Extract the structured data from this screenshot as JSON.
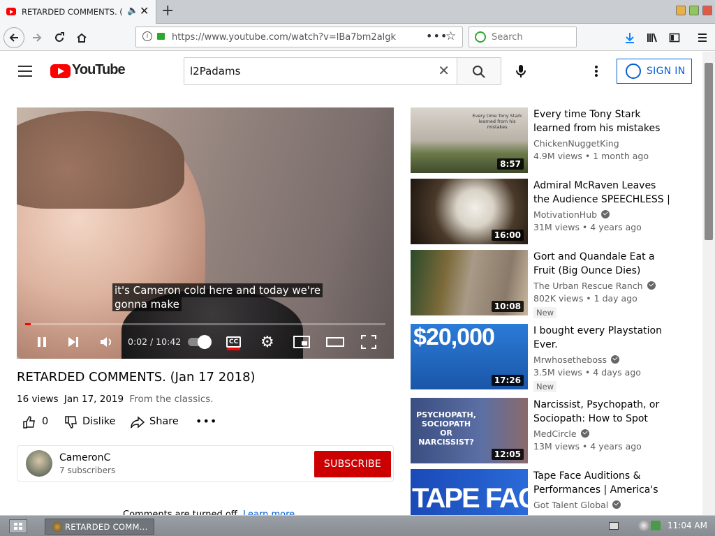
{
  "browser": {
    "tab_title": "RETARDED COMMENTS. (",
    "url": "https://www.youtube.com/watch?v=lBa7bm2algk",
    "search_placeholder": "Search"
  },
  "header": {
    "logo_text": "YouTube",
    "search_query": "l2Padams",
    "sign_in": "SIGN IN"
  },
  "player": {
    "caption_line1": "it's Cameron cold here and today we're",
    "caption_line2": "gonna make",
    "time": "0:02 / 10:42",
    "progress_fraction": 0.003
  },
  "video": {
    "title": "RETARDED COMMENTS. (Jan 17 2018)",
    "views": "16 views",
    "date": "Jan 17, 2019",
    "description": "From the classics.",
    "likes": "0",
    "dislike_label": "Dislike",
    "share_label": "Share"
  },
  "channel": {
    "name": "CameronC",
    "subscribers": "7 subscribers",
    "subscribe_label": "SUBSCRIBE"
  },
  "comments": {
    "text": "Comments are turned off.",
    "link": "Learn more"
  },
  "recommendations": [
    {
      "title": "Every time Tony Stark learned from his mistakes",
      "channel": "ChickenNuggetKing",
      "verified": false,
      "stats": "4.9M views • 1 month ago",
      "duration": "8:57",
      "new": false,
      "thumb_text": "Every time Tony Stark learned from his mistakes"
    },
    {
      "title": "Admiral McRaven Leaves the Audience SPEECHLESS | One...",
      "channel": "MotivationHub",
      "verified": true,
      "stats": "31M views • 4 years ago",
      "duration": "16:00",
      "new": false,
      "thumb_text": ""
    },
    {
      "title": "Gort and Quandale Eat a Fruit (Big Ounce Dies)",
      "channel": "The Urban Rescue Ranch",
      "verified": true,
      "stats": "802K views • 1 day ago",
      "duration": "10:08",
      "new": true,
      "thumb_text": ""
    },
    {
      "title": "I bought every Playstation Ever.",
      "channel": "Mrwhosetheboss",
      "verified": true,
      "stats": "3.5M views • 4 days ago",
      "duration": "17:26",
      "new": true,
      "thumb_text": "$20,000"
    },
    {
      "title": "Narcissist, Psychopath, or Sociopath: How to Spot the...",
      "channel": "MedCircle",
      "verified": true,
      "stats": "13M views • 4 years ago",
      "duration": "12:05",
      "new": false,
      "thumb_text": "PSYCHOPATH, SOCIOPATH OR NARCISSIST?"
    },
    {
      "title": "Tape Face Auditions & Performances | America's Go...",
      "channel": "Got Talent Global",
      "verified": true,
      "stats": "",
      "duration": "",
      "new": false,
      "thumb_text": "TAPE FACE"
    }
  ],
  "new_label": "New",
  "taskbar": {
    "task_label": "RETARDED COMM...",
    "clock": "11:04 AM"
  }
}
